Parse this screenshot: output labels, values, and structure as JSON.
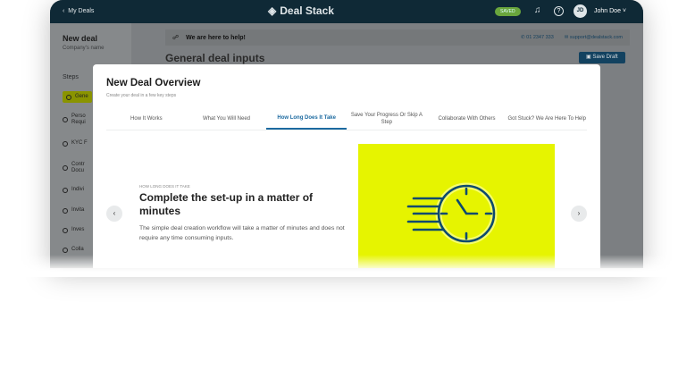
{
  "header": {
    "back": "My Deals",
    "logo": "Deal Stack",
    "saved_badge": "SAVED",
    "avatar_initials": "JD",
    "user": "John Doe"
  },
  "sidebar": {
    "title": "New deal",
    "subtitle": "Company's name",
    "steps_label": "Steps",
    "steps": [
      "Gene",
      "Perso\nRequi",
      "KYC F",
      "Contr\nDocu",
      "Indivi",
      "Invita",
      "Inves",
      "Colla"
    ]
  },
  "main": {
    "help_text": "We are here to help!",
    "phone": "01 2347 333",
    "email": "support@dealstack.com",
    "title": "General deal inputs",
    "save_draft": "Save Draft"
  },
  "modal": {
    "title": "New Deal Overview",
    "subtitle": "Create your deal in a few key steps",
    "tabs": [
      "How It Works",
      "What You Will Need",
      "How Long Does It Take",
      "Save Your Progress Or Skip A Step",
      "Collaborate With Others",
      "Got Stuck? We Are Here To Help"
    ],
    "active_tab": 2,
    "eyebrow": "HOW LONG DOES IT TAKE",
    "heading": "Complete the set-up in a matter of minutes",
    "body": "The simple deal creation workflow will take a matter of minutes and does not require any time consuming inputs.",
    "prev_icon": "‹",
    "next_icon": "›"
  },
  "colors": {
    "accent": "#1c6aa0",
    "highlight": "#e6f400",
    "header_bg": "#0f2936"
  }
}
